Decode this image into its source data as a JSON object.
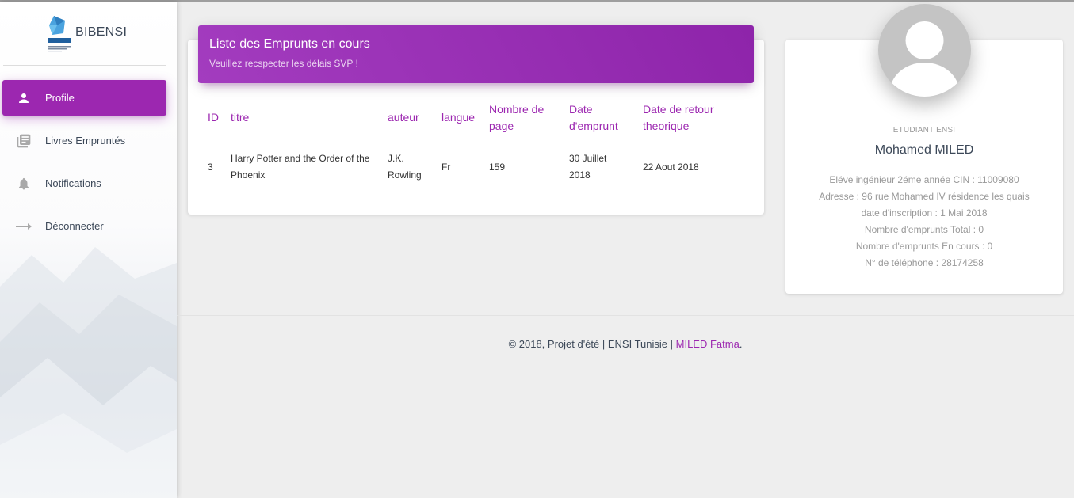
{
  "brand": {
    "name": "BIBENSI",
    "logo_text": "ENSI"
  },
  "sidebar": {
    "items": [
      {
        "label": "Profile",
        "icon": "person-icon",
        "active": true
      },
      {
        "label": "Livres Empruntés",
        "icon": "library-books-icon",
        "active": false
      },
      {
        "label": "Notifications",
        "icon": "bell-icon",
        "active": false
      },
      {
        "label": "Déconnecter",
        "icon": "arrow-right-icon",
        "active": false
      }
    ]
  },
  "loans_card": {
    "title": "Liste des Emprunts en cours",
    "subtitle": "Veuillez recspecter les délais SVP !",
    "columns": [
      [
        "ID"
      ],
      [
        "titre"
      ],
      [
        "auteur"
      ],
      [
        "langue"
      ],
      [
        "Nombre de",
        "page"
      ],
      [
        "Date",
        "d'emprunt"
      ],
      [
        "Date de retour",
        "theorique"
      ]
    ],
    "rows": [
      {
        "id": "3",
        "titre": [
          "Harry Potter and the Order of the",
          "Phoenix"
        ],
        "auteur": [
          "J.K.",
          "Rowling"
        ],
        "langue": "Fr",
        "pages": "159",
        "date_emprunt": [
          "30 Juillet",
          "2018"
        ],
        "date_retour": "22 Aout 2018"
      }
    ]
  },
  "profile": {
    "role": "ETUDIANT ENSI",
    "name": "Mohamed MILED",
    "lines": [
      "Eléve ingénieur 2éme année CIN : 11009080",
      "Adresse : 96 rue Mohamed IV résidence les quais",
      "date d'inscription : 1 Mai 2018",
      "Nombre d'emprunts Total : 0",
      "Nombre d'emprunts En cours : 0",
      "N° de téléphone : 28174258"
    ]
  },
  "footer": {
    "text": "© 2018, Projet d'été | ENSI Tunisie |",
    "link": "MILED Fatma",
    "end": "."
  },
  "colors": {
    "accent": "#9c27b0",
    "text": "#3c4858",
    "muted": "#999999"
  }
}
